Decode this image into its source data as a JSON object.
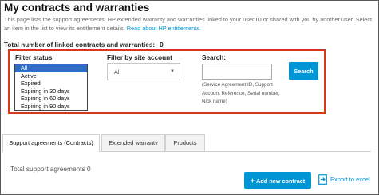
{
  "page": {
    "title": "My contracts and warranties",
    "description": "This page lists the support agreements, HP extended warranty and warranties linked to your user ID or shared with you by another user. Select an item in the list to view its entitlement details.",
    "description_link": "Read about HP entitlements.",
    "total_linked_label": "Total number of linked contracts and warranties:",
    "total_linked_value": "0"
  },
  "filters": {
    "status_label": "Filter status",
    "status_options": [
      "All",
      "Active",
      "Expired",
      "Expiring in 30 days",
      "Expiring in 60 days",
      "Expiring in 90 days"
    ],
    "status_selected_index": 0,
    "site_label": "Filter by site account",
    "site_value": "All",
    "search_label": "Search:",
    "search_value": "",
    "search_placeholder": "",
    "search_button": "Search",
    "search_hint": "(Service Agreement ID, Support Account Reference, Serial number, Nick name)"
  },
  "tabs": [
    {
      "label": "Support agreements (Contracts)",
      "active": true
    },
    {
      "label": "Extended warranty",
      "active": false
    },
    {
      "label": "Products",
      "active": false
    }
  ],
  "content": {
    "total_agreements_label": "Total support agreements",
    "total_agreements_value": "0",
    "add_button": "Add new contract",
    "export_link": "Export to excel"
  },
  "colors": {
    "accent": "#0096d6",
    "highlight_border": "#d9371b",
    "selected_option": "#2f6cc8"
  }
}
